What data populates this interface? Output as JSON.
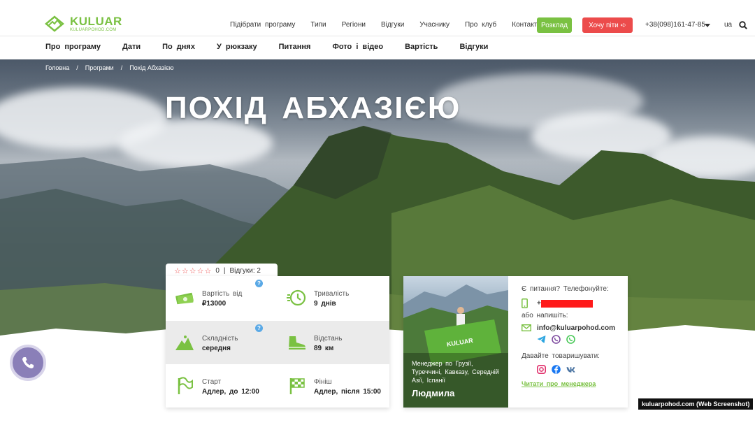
{
  "brand": {
    "name": "KULUAR",
    "site": "KULUARPOHOD.COM",
    "accent_color": "#7ac142",
    "danger_color": "#ec4b4b"
  },
  "top_nav": {
    "items": [
      "Підібрати програму",
      "Типи",
      "Регіони",
      "Відгуки",
      "Учаснику",
      "Про клуб",
      "Контакти"
    ],
    "schedule_label": "Розклад",
    "want_label": "Хочу піти ➪",
    "phone": "+38(098)161-47-85",
    "lang": "ua"
  },
  "sub_nav": {
    "items": [
      "Про програму",
      "Дати",
      "По днях",
      "У рюкзаку",
      "Питання",
      "Фото і відео",
      "Вартість",
      "Відгуки"
    ]
  },
  "breadcrumb": [
    "Головна",
    "/",
    "Програми",
    "/",
    "Похід Абхазією"
  ],
  "hero": {
    "title": "ПОХІД АБХАЗІЄЮ"
  },
  "rating": {
    "stars": "☆☆☆☆☆",
    "score": "0",
    "separator": "|",
    "reviews": "Відгуки: 2"
  },
  "info": {
    "price_label": "Вартість від",
    "price_value": "₽13000",
    "duration_label": "Тривалість",
    "duration_value": "9 днів",
    "difficulty_label": "Складність",
    "difficulty_value": "середня",
    "distance_label": "Відстань",
    "distance_value": "89 км",
    "start_label": "Старт",
    "start_value": "Адлер, до 12:00",
    "finish_label": "Фініш",
    "finish_value": "Адлер, після 15:00",
    "help_glyph": "?"
  },
  "manager": {
    "caption": "Менеджер по Грузії, Туреччині, Кавказу, Середній Азії, Іспанії",
    "name": "Людмила",
    "question": "Є питання? Телефонуйте:",
    "phone_prefix": "+",
    "or_write": "або напишіть:",
    "email": "info@kuluarpohod.com",
    "befriend": "Давайте товаришувати:",
    "read_more": "Читати про менеджера",
    "flag_text": "KULUAR"
  },
  "watermark": "kuluarpohod.com (Web Screenshot)"
}
